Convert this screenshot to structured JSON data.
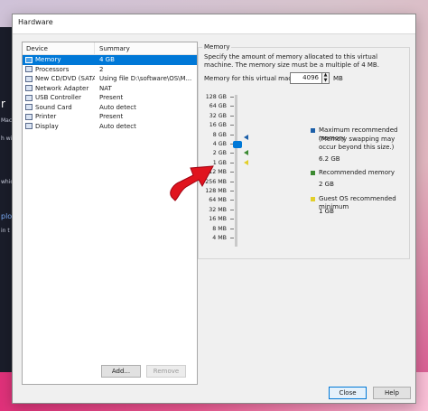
{
  "background": {
    "fragments": [
      "r",
      "Mac",
      "h wi",
      "which",
      "plo",
      "in t"
    ]
  },
  "window": {
    "title": "Hardware"
  },
  "device_list": {
    "columns": [
      "Device",
      "Summary"
    ],
    "rows": [
      {
        "icon": "memory-icon",
        "device": "Memory",
        "summary": "4 GB",
        "selected": true
      },
      {
        "icon": "processor-icon",
        "device": "Processors",
        "summary": "2",
        "selected": false
      },
      {
        "icon": "cd-dvd-icon",
        "device": "New CD/DVD (SATA)",
        "summary": "Using file D:\\software\\OS\\M...",
        "selected": false
      },
      {
        "icon": "network-adapter-icon",
        "device": "Network Adapter",
        "summary": "NAT",
        "selected": false
      },
      {
        "icon": "usb-icon",
        "device": "USB Controller",
        "summary": "Present",
        "selected": false
      },
      {
        "icon": "sound-card-icon",
        "device": "Sound Card",
        "summary": "Auto detect",
        "selected": false
      },
      {
        "icon": "printer-icon",
        "device": "Printer",
        "summary": "Present",
        "selected": false
      },
      {
        "icon": "display-icon",
        "device": "Display",
        "summary": "Auto detect",
        "selected": false
      }
    ],
    "add_label": "Add...",
    "remove_label": "Remove"
  },
  "memory": {
    "group_title": "Memory",
    "description": "Specify the amount of memory allocated to this virtual machine. The memory size must be a multiple of 4 MB.",
    "field_label": "Memory for this virtual machine:",
    "value": "4096",
    "unit": "MB",
    "ticks": [
      "128 GB",
      "64 GB",
      "32 GB",
      "16 GB",
      "8 GB",
      "4 GB",
      "2 GB",
      "1 GB",
      "512 MB",
      "256 MB",
      "128 MB",
      "64 MB",
      "32 MB",
      "16 MB",
      "8 MB",
      "4 MB"
    ],
    "selected_tick": "4 GB",
    "legend": [
      {
        "color": "#1c5fa8",
        "label": "Maximum recommended memory",
        "note": "(Memory swapping may occur beyond this size.)",
        "value": "6.2 GB",
        "tick_level": "6.2 GB"
      },
      {
        "color": "#3c8a32",
        "label": "Recommended memory",
        "note": "",
        "value": "2 GB",
        "tick_level": "2 GB"
      },
      {
        "color": "#e2cf2a",
        "label": "Guest OS recommended minimum",
        "note": "",
        "value": "1 GB",
        "tick_level": "1 GB"
      }
    ]
  },
  "footer": {
    "close_label": "Close",
    "help_label": "Help"
  },
  "colors": {
    "selection": "#0078d7",
    "annotation_arrow": "#e0141e"
  }
}
